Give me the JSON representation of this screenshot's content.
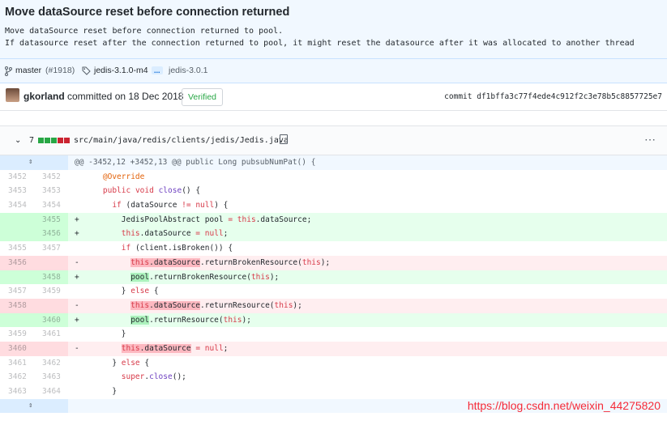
{
  "commit": {
    "title": "Move dataSource reset before connection returned",
    "description_lines": [
      "Move dataSource reset before connection returned to pool.",
      "If datasource reset after the connection returned to pool, it might reset the datasource after it was allocated to another thread"
    ],
    "branch": "master",
    "pr": "(#1918)",
    "tag_from": "jedis-3.1.0-m4",
    "ellipsis": "...",
    "tag_to": "jedis-3.0.1",
    "author": "gkorland",
    "committed_text": " committed on 18 Dec 2018",
    "verified": "Verified",
    "sha_label": "commit",
    "sha": "df1bffa3c77f4ede4c912f2c3e78b5c8857725e7"
  },
  "file": {
    "changes": "7",
    "stat": [
      "add",
      "add",
      "add",
      "del",
      "del"
    ],
    "colors": {
      "add": "#28a745",
      "del": "#cb2431"
    },
    "path": "src/main/java/redis/clients/jedis/Jedis.java",
    "icons": {
      "collapse": "chevron-down-icon",
      "copy": "clipboard-icon",
      "more": "kebab-icon",
      "expand": "unfold-icon"
    }
  },
  "hunk_header": "@@ -3452,12 +3452,13 @@ public Long pubsubNumPat() {",
  "lines": [
    {
      "type": "ctx",
      "old": "3452",
      "new": "3452",
      "code": "    @Override"
    },
    {
      "type": "ctx",
      "old": "3453",
      "new": "3453",
      "code": "    public void close() {"
    },
    {
      "type": "ctx",
      "old": "3454",
      "new": "3454",
      "code": "      if (dataSource != null) {"
    },
    {
      "type": "add",
      "old": "",
      "new": "3455",
      "code": "        JedisPoolAbstract pool = this.dataSource;"
    },
    {
      "type": "add",
      "old": "",
      "new": "3456",
      "code": "        this.dataSource = null;"
    },
    {
      "type": "ctx",
      "old": "3455",
      "new": "3457",
      "code": "        if (client.isBroken()) {"
    },
    {
      "type": "del",
      "old": "3456",
      "new": "",
      "code": "          this.dataSource.returnBrokenResource(this);"
    },
    {
      "type": "add",
      "old": "",
      "new": "3458",
      "code": "          pool.returnBrokenResource(this);"
    },
    {
      "type": "ctx",
      "old": "3457",
      "new": "3459",
      "code": "        } else {"
    },
    {
      "type": "del",
      "old": "3458",
      "new": "",
      "code": "          this.dataSource.returnResource(this);"
    },
    {
      "type": "add",
      "old": "",
      "new": "3460",
      "code": "          pool.returnResource(this);"
    },
    {
      "type": "ctx",
      "old": "3459",
      "new": "3461",
      "code": "        }"
    },
    {
      "type": "del",
      "old": "3460",
      "new": "",
      "code": "        this.dataSource = null;"
    },
    {
      "type": "ctx",
      "old": "3461",
      "new": "3462",
      "code": "      } else {"
    },
    {
      "type": "ctx",
      "old": "3462",
      "new": "3463",
      "code": "        super.close();"
    },
    {
      "type": "ctx",
      "old": "3463",
      "new": "3464",
      "code": "      }"
    }
  ],
  "watermark": "https://blog.csdn.net/weixin_44275820"
}
